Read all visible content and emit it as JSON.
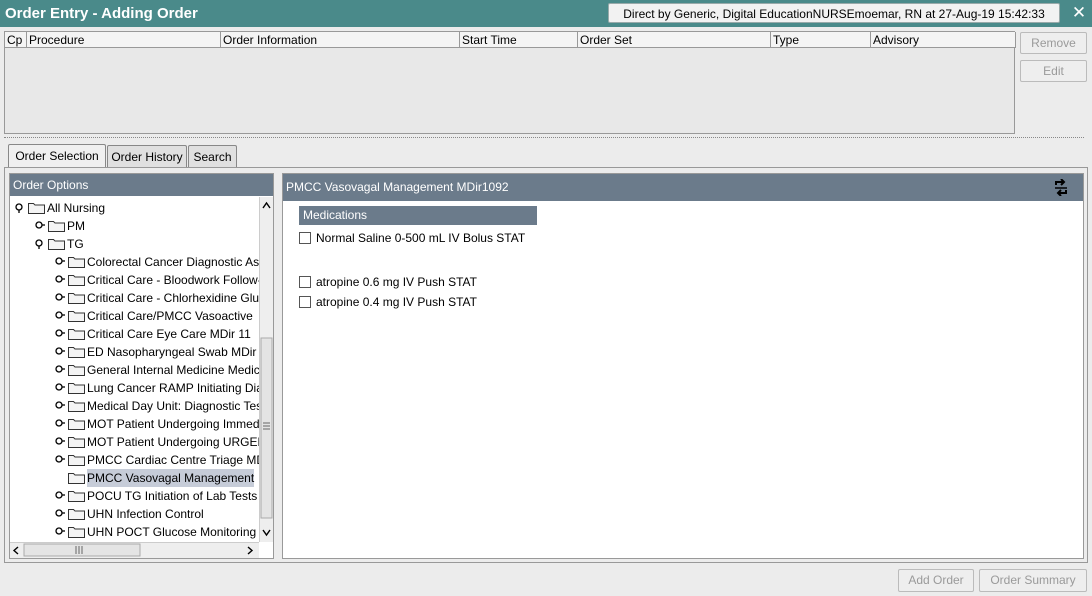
{
  "window": {
    "title": "Order Entry - Adding Order",
    "direct_by": "Direct by Generic, Digital EducationNURSEmoemar, RN at 27-Aug-19 15:42:33",
    "close_glyph": "✕"
  },
  "order_table": {
    "columns": [
      "Cp",
      "Procedure",
      "Order Information",
      "Start Time",
      "Order Set",
      "Type",
      "Advisory"
    ]
  },
  "side_buttons": {
    "remove": "Remove",
    "edit": "Edit"
  },
  "tabs": [
    {
      "label": "Order Selection",
      "active": true
    },
    {
      "label": "Order History",
      "active": false
    },
    {
      "label": "Search",
      "active": false
    }
  ],
  "order_options": {
    "header": "Order Options",
    "tree": [
      {
        "label": "All Nursing",
        "level": 0,
        "expanded": true
      },
      {
        "label": "PM",
        "level": 1,
        "expanded": false
      },
      {
        "label": "TG",
        "level": 1,
        "expanded": true
      },
      {
        "label": "Colorectal Cancer Diagnostic Assessment",
        "level": 2
      },
      {
        "label": "Critical Care - Bloodwork Follow-up",
        "level": 2
      },
      {
        "label": "Critical Care - Chlorhexidine Gluconate",
        "level": 2
      },
      {
        "label": "Critical Care/PMCC Vasoactive",
        "level": 2
      },
      {
        "label": "Critical Care Eye Care MDir 11",
        "level": 2
      },
      {
        "label": "ED Nasopharyngeal Swab MDir",
        "level": 2
      },
      {
        "label": "General Internal Medicine Medical",
        "level": 2
      },
      {
        "label": "Lung Cancer RAMP Initiating Diagnostic",
        "level": 2
      },
      {
        "label": "Medical Day Unit: Diagnostic Tests",
        "level": 2
      },
      {
        "label": "MOT Patient Undergoing Immediate",
        "level": 2
      },
      {
        "label": "MOT Patient Undergoing URGENT",
        "level": 2
      },
      {
        "label": "PMCC Cardiac Centre Triage MDir",
        "level": 2
      },
      {
        "label": "PMCC Vasovagal Management",
        "level": 2,
        "selected": true,
        "leaf": true
      },
      {
        "label": "POCU TG Initiation of Lab Tests",
        "level": 2
      },
      {
        "label": "UHN Infection Control",
        "level": 2
      },
      {
        "label": "UHN POCT Glucose Monitoring",
        "level": 2
      }
    ]
  },
  "detail": {
    "header": "PMCC Vasovagal Management MDir1092",
    "section": "Medications",
    "items": [
      {
        "label": "Normal Saline 0-500 mL IV Bolus STAT",
        "checked": false
      },
      {
        "label": "atropine 0.6 mg IV Push STAT",
        "checked": false
      },
      {
        "label": "atropine 0.4 mg IV Push STAT",
        "checked": false
      }
    ]
  },
  "bottom_buttons": {
    "add_order": "Add Order",
    "order_summary": "Order Summary"
  }
}
